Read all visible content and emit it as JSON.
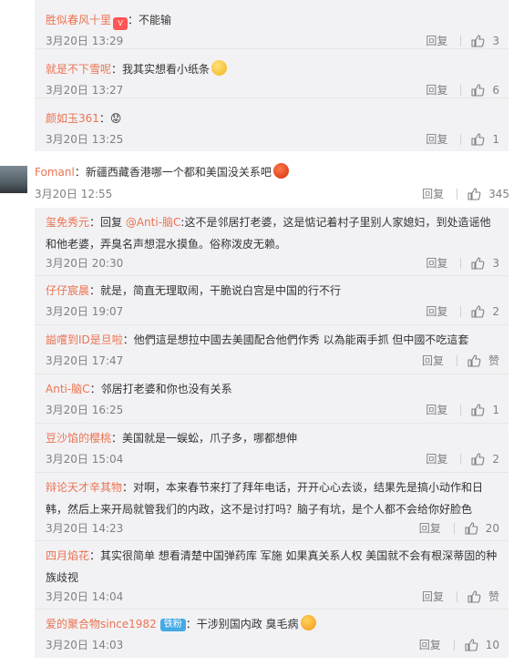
{
  "top_replies": [
    {
      "name": "胜似春风十里",
      "text": "：不能输",
      "time": "3月20日 13:29",
      "reply": "回复",
      "likes": "3"
    },
    {
      "name": "就是不下雪呢",
      "text": "：我其实想看小纸条",
      "time": "3月20日 13:27",
      "reply": "回复",
      "likes": "6"
    },
    {
      "name": "颜如玉361",
      "text": "：😟",
      "time": "3月20日 13:25",
      "reply": "回复",
      "likes": "1"
    }
  ],
  "main_comment": {
    "name": "Fomanl",
    "text": "：新疆西藏香港哪一个都和美国没关系吧",
    "time": "3月20日 12:55",
    "reply": "回复",
    "likes": "345"
  },
  "sub_replies": [
    {
      "name": "玺免秀元",
      "text": "：回复 ",
      "mention": "@Anti-脑C",
      "text2": ":这不是邻居打老婆，这是惦记着村子里别人家媳妇，到处造谣他和他老婆，弄臭名声想混水摸鱼。俗称泼皮无赖。",
      "time": "3月20日 20:30",
      "reply": "回复",
      "likes": "3"
    },
    {
      "name": "仔仔宸晨",
      "text": "：就是，简直无理取闹，干脆说白宫是中国的行不行",
      "time": "3月20日 19:07",
      "reply": "回复",
      "likes": "2"
    },
    {
      "name": "謚嚐到ID是旦啦",
      "text": "：他們這是想拉中國去美國配合他們作秀 以為能兩手抓 但中國不吃這套",
      "time": "3月20日 17:47",
      "reply": "回复",
      "likes": "赞"
    },
    {
      "name": "Anti-脑C",
      "text": "：邻居打老婆和你也没有关系",
      "time": "3月20日 16:25",
      "reply": "回复",
      "likes": "1"
    },
    {
      "name": "豆沙馅的樱桃",
      "text": "：美国就是一蜈蚣，爪子多，哪都想伸",
      "time": "3月20日 15:04",
      "reply": "回复",
      "likes": "2"
    },
    {
      "name": "辩论天才辛其物",
      "text": "：对啊，本来春节来打了拜年电话，开开心心去谈，结果先是搞小动作和日韩，然后上来开局就管我们的内政，这不是讨打吗？脑子有坑，是个人都不会给你好脸色",
      "time": "3月20日 14:23",
      "reply": "回复",
      "likes": "20"
    },
    {
      "name": "四月焰花",
      "text": "：其实很简单 想看清楚中国弹药库 军施 如果真关系人权  美国就不会有根深蒂固的种族歧视",
      "time": "3月20日 14:04",
      "reply": "回复",
      "likes": "赞"
    },
    {
      "name": "爱的聚合物since1982",
      "badge": "铁粉",
      "text": "：干涉别国内政  臭毛病",
      "time": "3月20日 14:03",
      "reply": "回复",
      "likes": "10"
    }
  ],
  "colors": {
    "name": "#eb7350",
    "mention": "#eb7350",
    "panel": "#f2f2f5",
    "muted": "#808080"
  }
}
